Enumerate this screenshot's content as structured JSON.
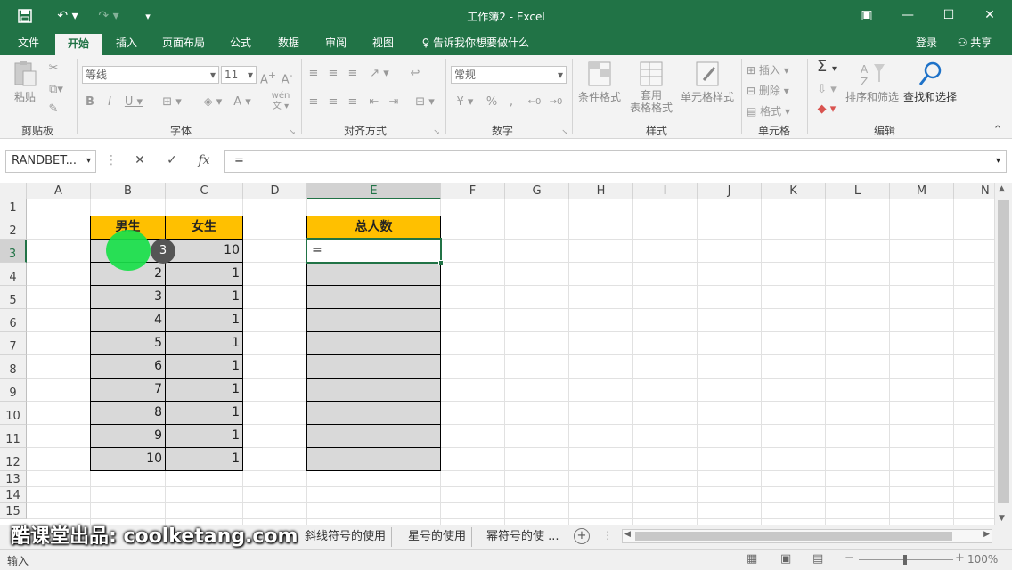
{
  "window": {
    "title": "工作簿2 - Excel"
  },
  "tabs": [
    {
      "label": "文件"
    },
    {
      "label": "开始"
    },
    {
      "label": "插入"
    },
    {
      "label": "页面布局"
    },
    {
      "label": "公式"
    },
    {
      "label": "数据"
    },
    {
      "label": "审阅"
    },
    {
      "label": "视图"
    },
    {
      "label": "告诉我你想要做什么"
    }
  ],
  "account": {
    "login": "登录",
    "share": "共享"
  },
  "ribbon": {
    "clipboard": {
      "paste": "粘贴",
      "label": "剪贴板"
    },
    "font": {
      "name": "等线",
      "size": "11",
      "label": "字体",
      "wen": "wén"
    },
    "align": {
      "label": "对齐方式"
    },
    "number": {
      "format": "常规",
      "label": "数字"
    },
    "styles": {
      "cond": "条件格式",
      "table1": "套用",
      "table2": "表格格式",
      "cell": "单元格样式",
      "label": "样式"
    },
    "cells": {
      "insert": "插入",
      "delete": "删除",
      "format": "格式",
      "label": "单元格"
    },
    "editing": {
      "sort": "排序和筛选",
      "find": "查找和选择",
      "label": "编辑"
    }
  },
  "formula_bar": {
    "name_box": "RANDBET...",
    "content": "=",
    "fx": "fx"
  },
  "grid": {
    "columns": [
      "A",
      "B",
      "C",
      "D",
      "E",
      "F",
      "G",
      "H",
      "I",
      "J",
      "K",
      "L",
      "M",
      "N"
    ],
    "rows": [
      "1",
      "2",
      "3",
      "4",
      "5",
      "6",
      "7",
      "8",
      "9",
      "10",
      "11",
      "12",
      "13",
      "14",
      "15"
    ],
    "selected_column": "E",
    "selected_row": "3",
    "headers": {
      "male": "男生",
      "female": "女生",
      "total": "总人数"
    },
    "male_values": [
      "3",
      "2",
      "3",
      "4",
      "5",
      "6",
      "7",
      "8",
      "9",
      "10"
    ],
    "female_values": [
      "10",
      "1",
      "1",
      "1",
      "1",
      "1",
      "1",
      "1",
      "1",
      "1"
    ],
    "active_cell_content": "="
  },
  "click_indicator": "3",
  "sheets": [
    "斜线符号的使用",
    "星号的使用",
    "幂符号的使 ..."
  ],
  "watermark": "酷课堂出品: coolketang.com",
  "status": {
    "mode": "输入",
    "zoom": "100%"
  },
  "colors": {
    "accent": "#217346",
    "header_fill": "#ffc000",
    "cell_fill": "#d9d9d9"
  }
}
